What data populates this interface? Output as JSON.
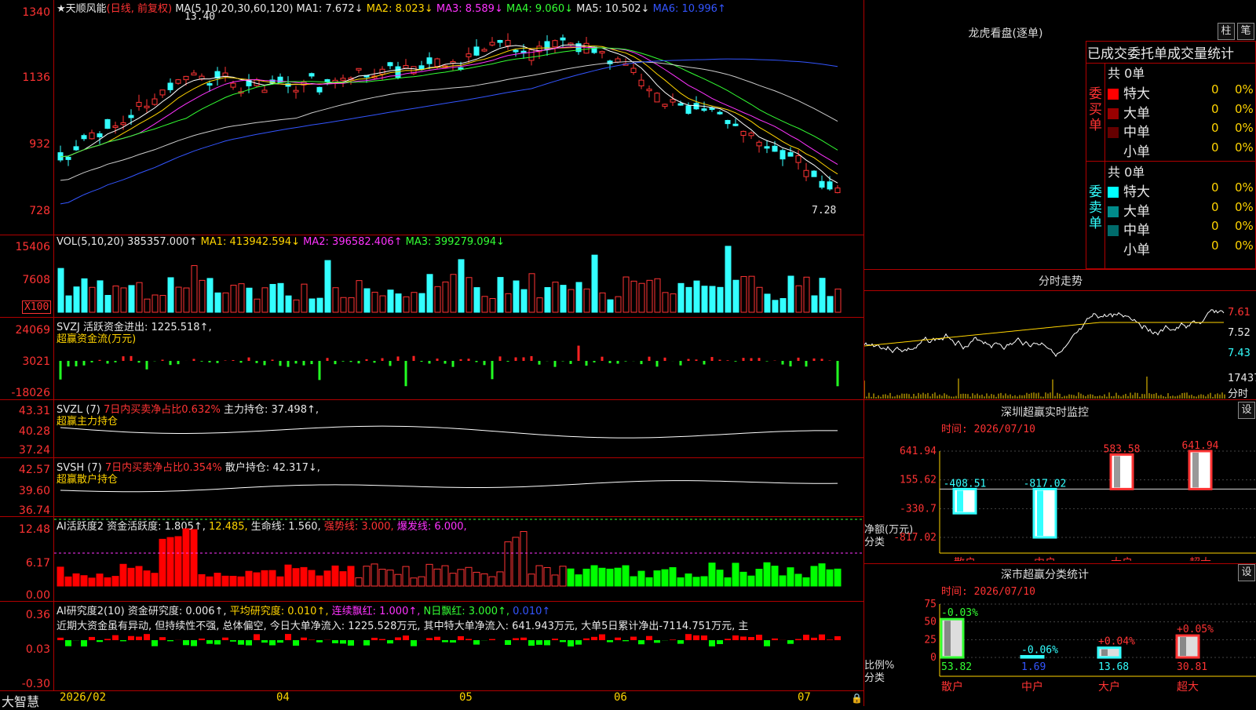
{
  "stock": {
    "name": "★天顺风能",
    "mode": "(日线, 前复权)",
    "high_label": "13.40",
    "low_label": "7.28"
  },
  "ma": {
    "header": "MA(5,10,20,30,60,120)",
    "ma1": "MA1: 7.672↓",
    "ma2": "MA2: 8.023↓",
    "ma3": "MA3: 8.589↓",
    "ma4": "MA4: 9.060↓",
    "ma5": "MA5: 10.502↓",
    "ma6": "MA6: 10.996↑"
  },
  "price_axis": [
    "1340",
    "1136",
    "932",
    "728"
  ],
  "vol": {
    "header": "VOL(5,10,20)",
    "value": "385357.000↑",
    "ma1": "MA1: 413942.594↓",
    "ma2": "MA2: 396582.406↑",
    "ma3": "MA3: 399279.094↓",
    "axis": [
      "15406",
      "7608"
    ],
    "unit": "X100"
  },
  "svzj": {
    "header": "SVZJ  活跃资金进出: 1225.518↑,",
    "sub": "超赢资金流(万元)",
    "axis": [
      "24069",
      "3021",
      "-18026"
    ]
  },
  "svzl": {
    "header": "SVZL (7) ",
    "pct": "7日内买卖净占比0.632%",
    "hold": "主力持仓: 37.498↑,",
    "sub": "超赢主力持仓",
    "axis": [
      "43.31",
      "40.28",
      "37.24"
    ]
  },
  "svsh": {
    "header": "SVSH (7) ",
    "pct": "7日内买卖净占比0.354%",
    "hold": "散户持仓: 42.317↓,",
    "sub": "超赢散户持仓",
    "axis": [
      "42.57",
      "39.60",
      "36.74"
    ]
  },
  "ai1": {
    "header": "AI活跃度2 资金活跃度: 1.805↑,",
    "v2": "12.485,",
    "life": "生命线: 1.560,",
    "strong": "强势线: 3.000,",
    "burst": "爆发线: 6.000,",
    "axis": [
      "12.48",
      "6.17",
      "0.00"
    ]
  },
  "ai2": {
    "header": "AI研究度2(10) 资金研究度: 0.006↑,",
    "avg": "平均研究度: 0.010↑,",
    "red": "连续飘红: 1.000↑,",
    "nred": "N日飘红: 3.000↑,",
    "nval": "0.010↑",
    "note": "近期大资金虽有异动, 但持续性不强, 总体偏空, 今日大单净流入: 1225.528万元, 其中特大单净流入: 641.943万元, 大单5日累计净出-7114.751万元, 主",
    "axis": [
      "0.36",
      "0.03",
      "-0.30"
    ]
  },
  "xaxis": {
    "brand": "大智慧",
    "labels": [
      "2026/02",
      "04",
      "05",
      "06",
      "07"
    ]
  },
  "right": {
    "dragon_title": "龙虎看盘(逐单)",
    "btn_bar": "柱",
    "btn_pen": "笔",
    "stat_title": "已成交委托单成交量统计",
    "buy_side": "委买单",
    "sell_side": "委卖单",
    "buy_total": "共 0单",
    "sell_total": "共 0单",
    "buy_rows": [
      {
        "label": "特大",
        "v": "0",
        "p": "0%",
        "color": "#ff0000"
      },
      {
        "label": "大单",
        "v": "0",
        "p": "0%",
        "color": "#990000"
      },
      {
        "label": "中单",
        "v": "0",
        "p": "0%",
        "color": "#660000"
      },
      {
        "label": "小单",
        "v": "0",
        "p": "0%",
        "color": "#000000"
      }
    ],
    "sell_rows": [
      {
        "label": "特大",
        "v": "0",
        "p": "0%",
        "color": "#00ffff"
      },
      {
        "label": "大单",
        "v": "0",
        "p": "0%",
        "color": "#008b8b"
      },
      {
        "label": "中单",
        "v": "0",
        "p": "0%",
        "color": "#006b6b"
      },
      {
        "label": "小单",
        "v": "0",
        "p": "0%",
        "color": "#000000"
      }
    ],
    "intraday_title": "分时走势",
    "intraday_axis": [
      "7.61",
      "7.52",
      "7.43"
    ],
    "intraday_vol": "17437",
    "intraday_vol_unit": "分时",
    "monitor_title": "深圳超赢实时监控",
    "monitor_btn": "设",
    "monitor_time": "时间: 2026/07/10",
    "monitor_axis": [
      "641.94",
      "155.62",
      "-330.7",
      "-817.02"
    ],
    "monitor_unit": "净额(万元)",
    "monitor_cat_label": "分类",
    "monitor_bars": [
      {
        "cat": "散户",
        "value": -408.51,
        "label": "-408.51"
      },
      {
        "cat": "中户",
        "value": -817.02,
        "label": "-817.02"
      },
      {
        "cat": "大户",
        "value": 583.58,
        "label": "583.58"
      },
      {
        "cat": "超大",
        "value": 641.94,
        "label": "641.94"
      }
    ],
    "class_title": "深市超赢分类统计",
    "class_btn": "设",
    "class_time": "时间: 2026/07/10",
    "class_axis": [
      "75",
      "50",
      "25",
      "0"
    ],
    "class_unit": "比例%",
    "class_cat_label": "分类",
    "class_bars": [
      {
        "cat": "散户",
        "value": 53.82,
        "label": "53.82",
        "chg": "-0.03%"
      },
      {
        "cat": "中户",
        "value": 1.69,
        "label": "1.69",
        "chg": "-0.06%"
      },
      {
        "cat": "大户",
        "value": 13.68,
        "label": "13.68",
        "chg": "+0.04%"
      },
      {
        "cat": "超大",
        "value": 30.81,
        "label": "30.81",
        "chg": "+0.05%"
      }
    ]
  },
  "chart_data": [
    {
      "type": "bar",
      "title": "深圳超赢实时监控",
      "ylabel": "净额(万元)",
      "categories": [
        "散户",
        "中户",
        "大户",
        "超大"
      ],
      "values": [
        -408.51,
        -817.02,
        583.58,
        641.94
      ],
      "ylim": [
        -817.02,
        641.94
      ]
    },
    {
      "type": "bar",
      "title": "深市超赢分类统计",
      "ylabel": "比例%",
      "categories": [
        "散户",
        "中户",
        "大户",
        "超大"
      ],
      "values": [
        53.82,
        1.69,
        13.68,
        30.81
      ],
      "changes": [
        "-0.03%",
        "-0.06%",
        "+0.04%",
        "+0.05%"
      ],
      "ylim": [
        0,
        75
      ]
    }
  ]
}
